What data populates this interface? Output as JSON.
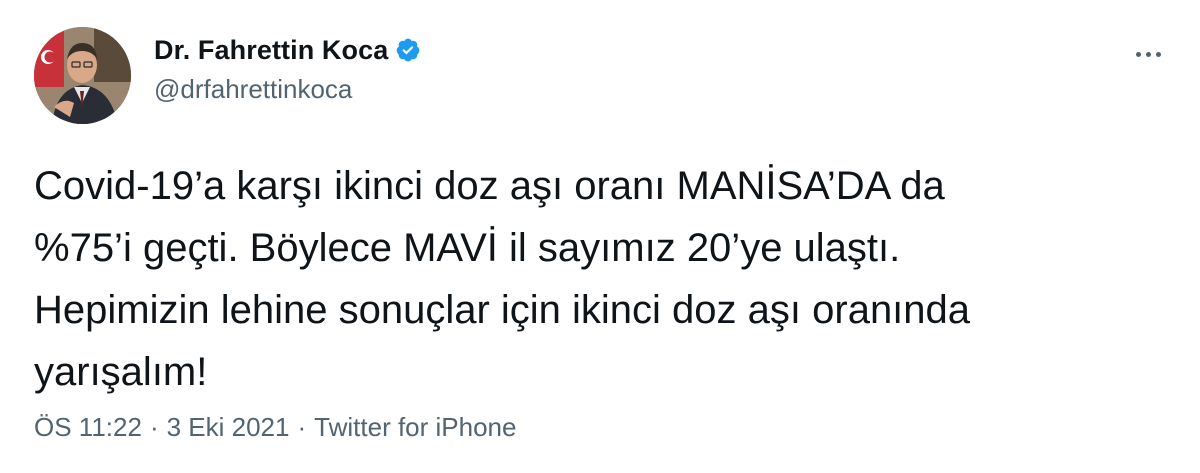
{
  "author": {
    "display_name": "Dr. Fahrettin Koca",
    "handle": "@drfahrettinkoca",
    "verified": true,
    "verified_icon": "verified-badge-icon",
    "avatar_icon": "profile-photo"
  },
  "tweet": {
    "lines": [
      "Covid-19’a karşı ikinci doz aşı oranı MANİSA’DA da",
      "%75’i geçti. Böylece MAVİ il sayımız 20’ye ulaştı.",
      "Hepimizin lehine sonuçlar için ikinci doz aşı oranında",
      "yarışalım!"
    ]
  },
  "meta": {
    "time": "ÖS 11:22",
    "date": "3 Eki 2021",
    "separator": "·",
    "source": "Twitter for iPhone"
  },
  "colors": {
    "text": "#0f1419",
    "secondary": "#536471",
    "verified": "#1d9bf0"
  },
  "menu": {
    "icon": "more-options-icon"
  }
}
